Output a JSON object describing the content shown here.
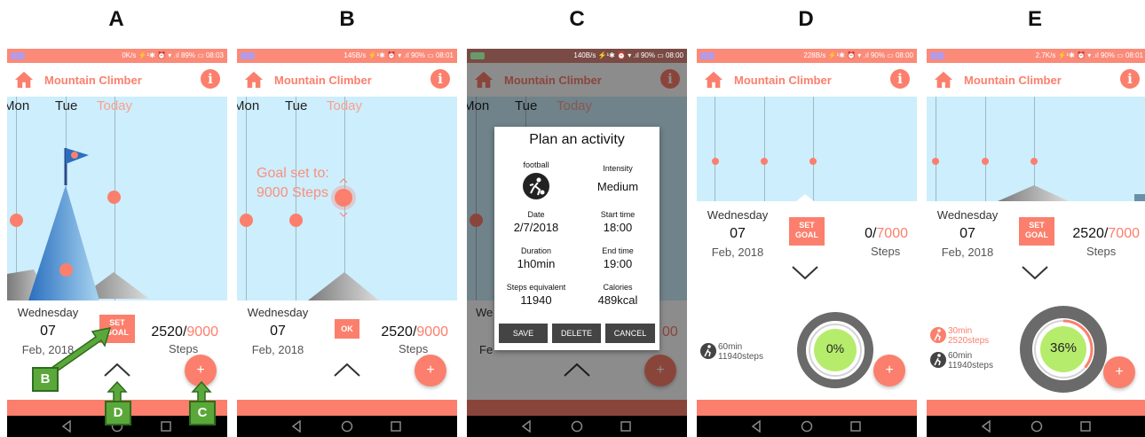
{
  "panel_labels": [
    "A",
    "B",
    "C",
    "D",
    "E"
  ],
  "app": {
    "title": "Mountain Climber",
    "info_glyph": "i"
  },
  "status_bars": {
    "A": "0K/s ⚡¹✱ ⏰ ▾ .ıl 89% ▭ 08:03",
    "B": "145B/s ⚡¹✱ ⏰ ▾ .ıl 90% ▭ 08:01",
    "C": "140B/s ⚡¹✱ ⏰ ▾ .ıl 90% ▭ 08:00",
    "D": "228B/s ⚡¹✱ ⏰ ▾ .ıl 90% ▭ 08:00",
    "E": "2.7K/s ⚡¹✱ ⏰ ▾ .ıl 90% ▭ 08:01"
  },
  "days": {
    "d1": "Mon",
    "d2": "Tue",
    "d3": "Today"
  },
  "date": {
    "weekday": "Wednesday",
    "day": "07",
    "month_year": "Feb, 2018"
  },
  "panel_a": {
    "set_goal": "SET\nGOAL",
    "steps": "2520/",
    "goal": "9000",
    "steps_label": "Steps",
    "fab": "+"
  },
  "panel_b": {
    "goal_text_1": "Goal set to:",
    "goal_text_2": "9000 Steps",
    "ok": "OK",
    "steps": "2520/",
    "goal": "9000",
    "steps_label": "Steps",
    "fab": "+"
  },
  "panel_c": {
    "dialog_title": "Plan an activity",
    "activity": "football",
    "intensity_label": "Intensity",
    "intensity": "Medium",
    "date_label": "Date",
    "date": "2/7/2018",
    "start_label": "Start time",
    "start": "18:00",
    "duration_label": "Duration",
    "duration": "1h0min",
    "end_label": "End time",
    "end": "19:00",
    "stepsq_label": "Steps equivalent",
    "stepsq": "11940",
    "cal_label": "Calories",
    "cal": "489kcal",
    "save": "SAVE",
    "delete": "DELETE",
    "cancel": "CANCEL",
    "bg_steps_partial": "00",
    "bg_weekday_partial": "We",
    "bg_month_partial": "Fe"
  },
  "panel_d": {
    "set_goal": "SET\nGOAL",
    "steps": "0/",
    "goal": "7000",
    "steps_label": "Steps",
    "activity": {
      "time": "60min",
      "steps": "11940steps"
    },
    "ring_pct": "0%",
    "progress": 0.0,
    "fab": "+"
  },
  "panel_e": {
    "set_goal": "SET\nGOAL",
    "steps": "2520/",
    "goal": "7000",
    "steps_label": "Steps",
    "activity1": {
      "time": "30min",
      "steps": "2520steps"
    },
    "activity2": {
      "time": "60min",
      "steps": "11940steps"
    },
    "ring_pct": "36%",
    "progress": 0.36,
    "fab": "+"
  },
  "callouts": {
    "b": "B",
    "d": "D",
    "c": "C"
  },
  "colors": {
    "accent": "#fb7f6c",
    "sky": "#cdeefc",
    "ring_inner": "#b6ec6c",
    "ring_outer": "#6a6a6a",
    "callout": "#5aa83a"
  }
}
